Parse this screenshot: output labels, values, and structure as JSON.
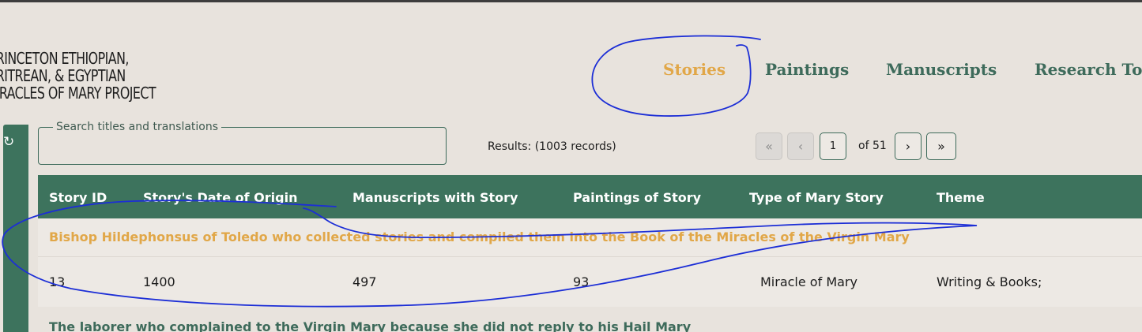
{
  "logo": {
    "lines": [
      "RINCETON ETHIOPIAN,",
      "RITREAN, & EGYPTIAN",
      "IRACLES OF MARY PROJECT"
    ]
  },
  "nav": [
    {
      "label": "Stories",
      "active": true
    },
    {
      "label": "Paintings",
      "active": false
    },
    {
      "label": "Manuscripts",
      "active": false
    },
    {
      "label": "Research Too",
      "active": false
    }
  ],
  "search": {
    "label": "Search titles and translations",
    "value": ""
  },
  "results": {
    "text": "Results: (1003 records)"
  },
  "pager": {
    "first": "«",
    "prev": "‹",
    "page": "1",
    "of": "of 51",
    "next": "›",
    "last": "»"
  },
  "table": {
    "headers": [
      "Story ID",
      "Story's Date of Origin",
      "Manuscripts with Story",
      "Paintings of Story",
      "Type of Mary Story",
      "Theme"
    ],
    "rows": [
      {
        "title": "Bishop Hildephonsus of Toledo who collected stories and compiled them into the Book of the Miracles of the Virgin Mary",
        "title_color": "#e1a748",
        "cells": [
          "13",
          "1400",
          "497",
          "93",
          "Miracle of Mary",
          "Writing & Books;"
        ]
      },
      {
        "title": "The laborer who complained to the Virgin Mary because she did not reply to his Hail Mary",
        "title_color": "#3e6b5b"
      }
    ]
  },
  "colors": {
    "accent": "#e1a748",
    "brand": "#3d735d",
    "annotation": "#1c2ed6"
  }
}
